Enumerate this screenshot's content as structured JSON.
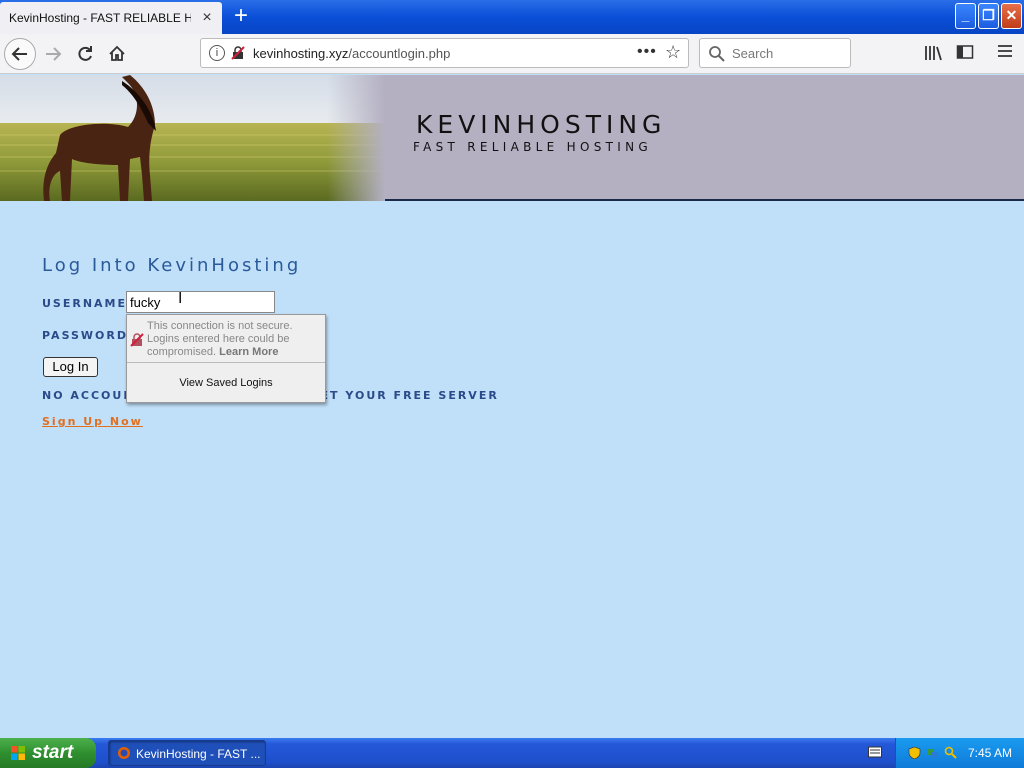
{
  "browser": {
    "tab_title": "KevinHosting - FAST RELIABLE HOSTING",
    "tab_close": "×",
    "new_tab": "+",
    "url_domain": "kevinhosting.xyz",
    "url_path": "/accountlogin.php",
    "url_more": "•••",
    "search_placeholder": "Search"
  },
  "site": {
    "title": "KEVINHOSTING",
    "tagline": "FAST RELIABLE HOSTING"
  },
  "login": {
    "heading": "Log Into KevinHosting",
    "username_label": "USERNAME",
    "username_value": "fucky",
    "password_label": "PASSWORD",
    "login_button": "Log In",
    "no_account_prefix": "NO ACCOUN",
    "no_account_suffix": "ET YOUR FREE SERVER",
    "signup_link": "Sign Up Now"
  },
  "popup": {
    "warning": "This connection is not secure. Logins entered here could be compromised.",
    "learn_more": "Learn More",
    "view_saved": "View Saved Logins"
  },
  "taskbar": {
    "start_label": "start",
    "task_label": "KevinHosting - FAST ...",
    "clock": "7:45 AM"
  },
  "colors": {
    "page_bg": "#c0dff8",
    "banner_bg": "#b4b0c2",
    "heading": "#2a5a9a",
    "signup": "#e07020",
    "taskbar": "#245edc",
    "start": "#2f8f2f"
  }
}
